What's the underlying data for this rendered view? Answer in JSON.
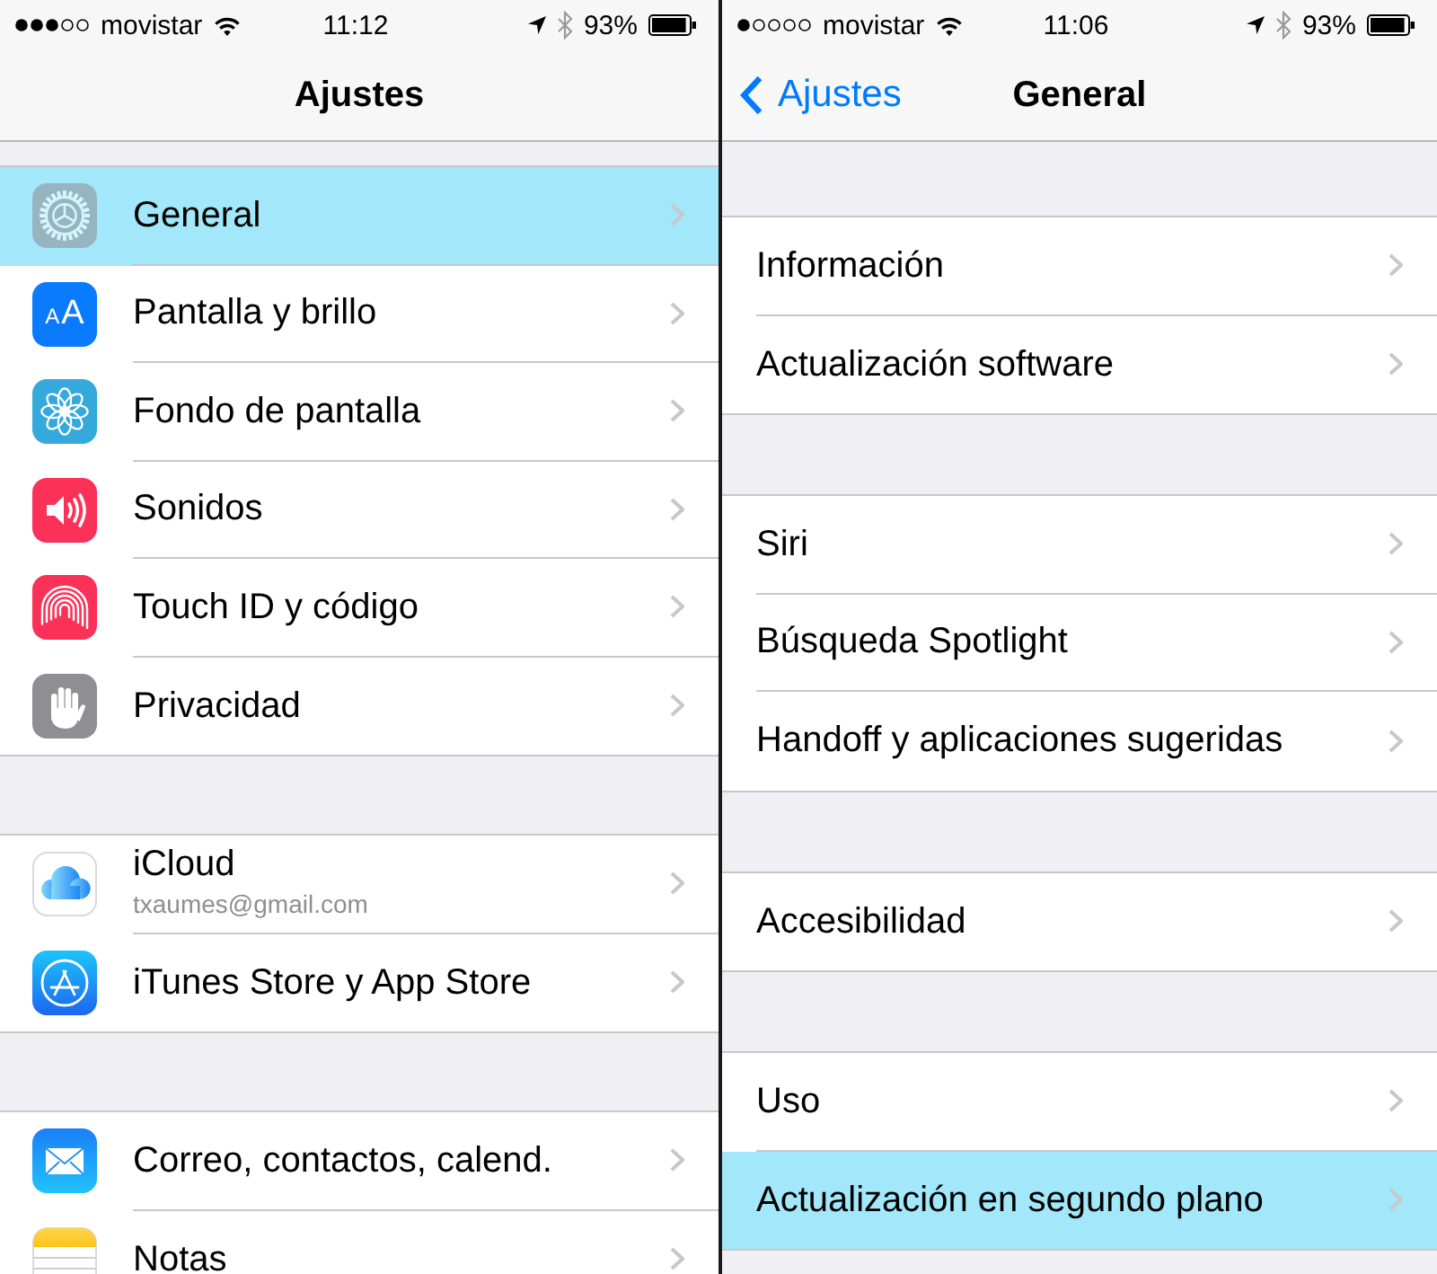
{
  "panels": [
    {
      "status_bar": {
        "carrier": "movistar",
        "time": "11:12",
        "battery": "93%"
      },
      "nav_bar": {
        "title": "Ajustes"
      },
      "groups": [
        {
          "items": [
            {
              "label": "General",
              "selected": true
            },
            {
              "label": "Pantalla y brillo",
              "selected": false,
              "icon_text": [
                "A",
                "A"
              ]
            },
            {
              "label": "Fondo de pantalla",
              "selected": false
            },
            {
              "label": "Sonidos",
              "selected": false
            },
            {
              "label": "Touch ID y código",
              "selected": false
            },
            {
              "label": "Privacidad",
              "selected": false
            }
          ]
        },
        {
          "items": [
            {
              "label": "iCloud",
              "subtitle": "txaumes@gmail.com",
              "selected": false
            },
            {
              "label": "iTunes Store y App Store",
              "selected": false
            }
          ]
        },
        {
          "items": [
            {
              "label": "Correo, contactos, calend.",
              "selected": false
            },
            {
              "label": "Notas",
              "selected": false
            }
          ]
        }
      ]
    },
    {
      "status_bar": {
        "carrier": "movistar",
        "time": "11:06",
        "battery": "93%"
      },
      "nav_bar": {
        "back": "Ajustes",
        "title": "General"
      },
      "groups": [
        {
          "items": [
            {
              "label": "Información",
              "selected": false
            },
            {
              "label": "Actualización software",
              "selected": false
            }
          ]
        },
        {
          "items": [
            {
              "label": "Siri",
              "selected": false
            },
            {
              "label": "Búsqueda Spotlight",
              "selected": false
            },
            {
              "label": "Handoff y aplicaciones sugeridas",
              "selected": false
            }
          ]
        },
        {
          "items": [
            {
              "label": "Accesibilidad",
              "selected": false
            }
          ]
        },
        {
          "items": [
            {
              "label": "Uso",
              "selected": false
            },
            {
              "label": "Actualización en segundo plano",
              "selected": true
            }
          ]
        }
      ]
    }
  ]
}
